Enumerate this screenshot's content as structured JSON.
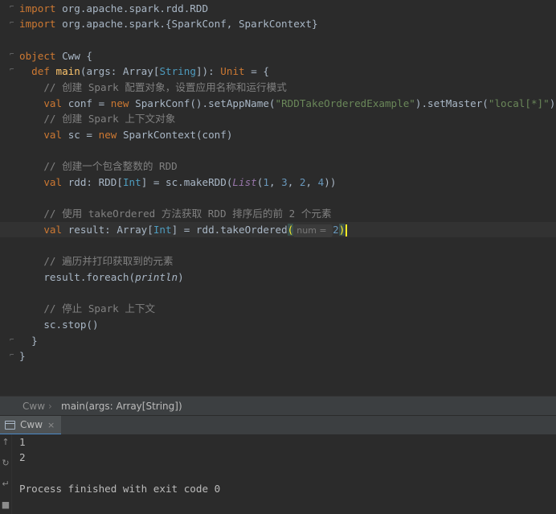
{
  "editor": {
    "lines": [
      {
        "tokens": [
          {
            "c": "t-kw",
            "t": "import "
          },
          {
            "c": "t-plain",
            "t": "org.apache.spark.rdd.RDD"
          }
        ]
      },
      {
        "tokens": [
          {
            "c": "t-kw",
            "t": "import "
          },
          {
            "c": "t-plain",
            "t": "org.apache.spark.{SparkConf, SparkContext}"
          }
        ]
      },
      {
        "tokens": []
      },
      {
        "tokens": [
          {
            "c": "t-kw",
            "t": "object "
          },
          {
            "c": "t-plain",
            "t": "Cww {"
          }
        ]
      },
      {
        "tokens": [
          {
            "c": "t-plain",
            "t": "  "
          },
          {
            "c": "t-kw",
            "t": "def "
          },
          {
            "c": "t-fn",
            "t": "main"
          },
          {
            "c": "t-plain",
            "t": "(args: Array["
          },
          {
            "c": "t-type",
            "t": "String"
          },
          {
            "c": "t-plain",
            "t": "]): "
          },
          {
            "c": "t-kw",
            "t": "Unit"
          },
          {
            "c": "t-plain",
            "t": " = {"
          }
        ]
      },
      {
        "tokens": [
          {
            "c": "t-cmt",
            "t": "    // 创建 Spark 配置对象，设置应用名称和运行模式"
          }
        ]
      },
      {
        "tokens": [
          {
            "c": "t-plain",
            "t": "    "
          },
          {
            "c": "t-kw",
            "t": "val "
          },
          {
            "c": "t-plain",
            "t": "conf = "
          },
          {
            "c": "t-kw",
            "t": "new "
          },
          {
            "c": "t-plain",
            "t": "SparkConf().setAppName("
          },
          {
            "c": "t-str",
            "t": "\"RDDTakeOrderedExample\""
          },
          {
            "c": "t-plain",
            "t": ").setMaster("
          },
          {
            "c": "t-str",
            "t": "\"local[*]\""
          },
          {
            "c": "t-plain",
            "t": ")"
          }
        ]
      },
      {
        "tokens": [
          {
            "c": "t-cmt",
            "t": "    // 创建 Spark 上下文对象"
          }
        ]
      },
      {
        "tokens": [
          {
            "c": "t-plain",
            "t": "    "
          },
          {
            "c": "t-kw",
            "t": "val "
          },
          {
            "c": "t-plain",
            "t": "sc = "
          },
          {
            "c": "t-kw",
            "t": "new "
          },
          {
            "c": "t-plain",
            "t": "SparkContext(conf)"
          }
        ]
      },
      {
        "tokens": []
      },
      {
        "tokens": [
          {
            "c": "t-cmt",
            "t": "    // 创建一个包含整数的 RDD"
          }
        ]
      },
      {
        "tokens": [
          {
            "c": "t-plain",
            "t": "    "
          },
          {
            "c": "t-kw",
            "t": "val "
          },
          {
            "c": "t-plain",
            "t": "rdd: RDD["
          },
          {
            "c": "t-type",
            "t": "Int"
          },
          {
            "c": "t-plain",
            "t": "] = sc.makeRDD("
          },
          {
            "c": "t-ital",
            "t": "List"
          },
          {
            "c": "t-plain",
            "t": "("
          },
          {
            "c": "t-num",
            "t": "1"
          },
          {
            "c": "t-plain",
            "t": ", "
          },
          {
            "c": "t-num",
            "t": "3"
          },
          {
            "c": "t-plain",
            "t": ", "
          },
          {
            "c": "t-num",
            "t": "2"
          },
          {
            "c": "t-plain",
            "t": ", "
          },
          {
            "c": "t-num",
            "t": "4"
          },
          {
            "c": "t-plain",
            "t": "))"
          }
        ]
      },
      {
        "tokens": []
      },
      {
        "tokens": [
          {
            "c": "t-cmt",
            "t": "    // 使用 takeOrdered 方法获取 RDD 排序后的前 2 个元素"
          }
        ]
      },
      {
        "current": true,
        "tokens": [
          {
            "c": "t-plain",
            "t": "    "
          },
          {
            "c": "t-kw",
            "t": "val "
          },
          {
            "c": "t-plain",
            "t": "result: Array["
          },
          {
            "c": "t-type",
            "t": "Int"
          },
          {
            "c": "t-plain",
            "t": "] = rdd.takeOrdered"
          },
          {
            "c": "paren-match",
            "t": "("
          },
          {
            "c": "hint",
            "t": "num = "
          },
          {
            "c": "t-num",
            "t": "2"
          },
          {
            "c": "paren-match",
            "t": ")"
          },
          {
            "c": "caret",
            "t": ""
          }
        ]
      },
      {
        "tokens": []
      },
      {
        "tokens": [
          {
            "c": "t-cmt",
            "t": "    // 遍历并打印获取到的元素"
          }
        ]
      },
      {
        "tokens": [
          {
            "c": "t-plain",
            "t": "    result.foreach("
          },
          {
            "c": "t-ital2",
            "t": "println"
          },
          {
            "c": "t-plain",
            "t": ")"
          }
        ]
      },
      {
        "tokens": []
      },
      {
        "tokens": [
          {
            "c": "t-cmt",
            "t": "    // 停止 Spark 上下文"
          }
        ]
      },
      {
        "tokens": [
          {
            "c": "t-plain",
            "t": "    sc.stop()"
          }
        ]
      },
      {
        "tokens": [
          {
            "c": "t-plain",
            "t": "  }"
          }
        ]
      },
      {
        "tokens": [
          {
            "c": "t-plain",
            "t": "}"
          }
        ]
      }
    ]
  },
  "breadcrumb": {
    "object": "Cww",
    "separator": "›",
    "method": "main(args: Array[String])"
  },
  "run_panel": {
    "tab_label": "Cww",
    "close": "×",
    "output": [
      "1",
      "2",
      "",
      "Process finished with exit code 0"
    ]
  },
  "icons": {
    "tab": "console-icon",
    "tools": [
      "scroll-up-icon",
      "restart-icon",
      "stop-icon",
      "wrap-icon"
    ]
  }
}
